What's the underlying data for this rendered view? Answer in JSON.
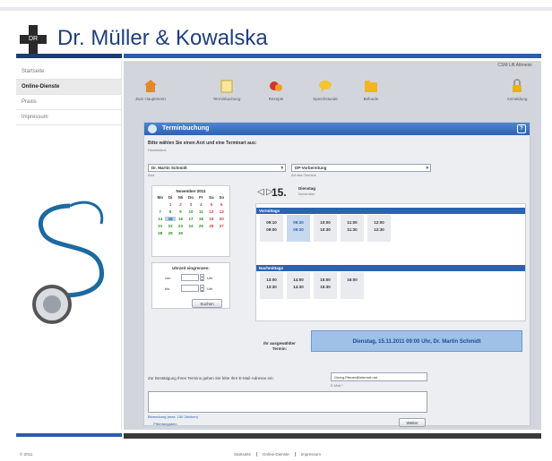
{
  "header": {
    "brand": "Dr. Müller & Kowalska",
    "logo_text": "DR"
  },
  "nav": [
    {
      "label": "Startseite"
    },
    {
      "label": "Online-Dienste"
    },
    {
      "label": "Praxis"
    },
    {
      "label": "Impressum"
    }
  ],
  "account": "CSM Lift Altmeier",
  "toolbar": [
    {
      "label": "Zum Hauptmenü"
    },
    {
      "label": "Terminbuchung"
    },
    {
      "label": "Rezepte"
    },
    {
      "label": "Sprechstunde"
    },
    {
      "label": "Befunde"
    },
    {
      "label": "Anmeldung"
    }
  ],
  "panel": {
    "title": "Terminbuchung",
    "help": "?",
    "instruction": "Bitte wählen Sie einen Arzt und eine Terminart aus:",
    "subtext": "Hinweistext",
    "doctor": "Dr. Martin Schmidt",
    "doctor_label": "Arzt",
    "type": "DP-Vorbereitung",
    "type_label": "Art des Termins"
  },
  "calendar": {
    "title": "November  2011",
    "weekdays": [
      "Mo",
      "Di",
      "Mi",
      "Do",
      "Fr",
      "Sa",
      "So"
    ],
    "rows": [
      [
        "",
        "1",
        "2",
        "3",
        "4",
        "5",
        "6"
      ],
      [
        "7",
        "8",
        "9",
        "10",
        "11",
        "12",
        "13"
      ],
      [
        "14",
        "15",
        "16",
        "17",
        "18",
        "19",
        "20"
      ],
      [
        "21",
        "22",
        "23",
        "24",
        "25",
        "26",
        "27"
      ],
      [
        "28",
        "29",
        "30",
        "",
        "",
        "",
        ""
      ]
    ]
  },
  "timerange": {
    "title": "Uhrzeit eingrenzen:",
    "from": "von",
    "to": "bis",
    "unit": "Uhr",
    "button": "Suchen"
  },
  "day": {
    "number": "15.",
    "name": "Dienstag",
    "sub": "November"
  },
  "slots": {
    "morning_label": "Vormittags",
    "morning": [
      [
        "09:10",
        "09:30",
        "10:00",
        "11:00",
        "12:00"
      ],
      [
        "09:00",
        "09:30",
        "10:30",
        "11:30",
        "12:30"
      ]
    ],
    "afternoon_label": "Nachmittags",
    "afternoon": [
      [
        "13:00",
        "14:00",
        "15:00",
        "16:00"
      ],
      [
        "13:30",
        "14:30",
        "15:30",
        ""
      ]
    ]
  },
  "summary": {
    "label": "Ihr ausgewählter Termin:",
    "value": "Dienstag, 15.11.2011 09:00 Uhr, Dr. Martin Schmidt"
  },
  "email": {
    "instruction": "Zur Bestätigung Ihres Termins geben Sie bitte Ihre E-Mail-Adresse ein:",
    "value": "Georg.Pfeuer@internet.net",
    "field_label": "E-Mail *"
  },
  "remarks": {
    "label": "Bemerkung (max. 150 Zeichen)",
    "required": "Pflichtangaben",
    "submit": "Weiter"
  },
  "footer": {
    "copyright": "© 2011",
    "links": [
      "Startseite",
      "Online-Dienste",
      "Impressum"
    ]
  }
}
